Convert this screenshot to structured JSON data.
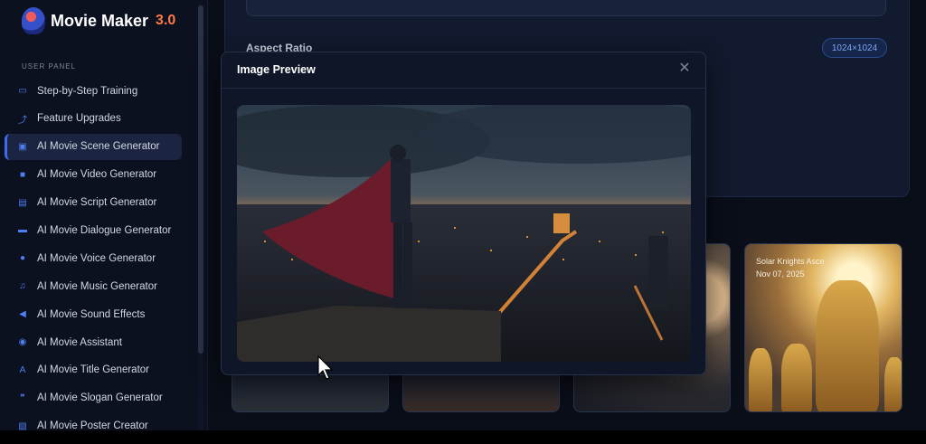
{
  "app": {
    "name": "Movie Maker",
    "version": "3.0"
  },
  "sidebar": {
    "section_label": "USER PANEL",
    "items": [
      {
        "label": "Step-by-Step Training",
        "icon": "training-icon",
        "glyph": "▭",
        "active": false
      },
      {
        "label": "Feature Upgrades",
        "icon": "upgrade-icon",
        "glyph": "⤴",
        "active": false
      },
      {
        "label": "AI Movie Scene Generator",
        "icon": "scene-icon",
        "glyph": "▣",
        "active": true
      },
      {
        "label": "AI Movie Video Generator",
        "icon": "video-icon",
        "glyph": "■",
        "active": false
      },
      {
        "label": "AI Movie Script Generator",
        "icon": "script-icon",
        "glyph": "▤",
        "active": false
      },
      {
        "label": "AI Movie Dialogue Generator",
        "icon": "dialogue-icon",
        "glyph": "▬",
        "active": false
      },
      {
        "label": "AI Movie Voice Generator",
        "icon": "microphone-icon",
        "glyph": "●",
        "active": false
      },
      {
        "label": "AI Movie Music Generator",
        "icon": "music-icon",
        "glyph": "♫",
        "active": false
      },
      {
        "label": "AI Movie Sound Effects",
        "icon": "speaker-icon",
        "glyph": "◀",
        "active": false
      },
      {
        "label": "AI Movie Assistant",
        "icon": "assistant-icon",
        "glyph": "◉",
        "active": false
      },
      {
        "label": "AI Movie Title Generator",
        "icon": "title-icon",
        "glyph": "A",
        "active": false
      },
      {
        "label": "AI Movie Slogan Generator",
        "icon": "quote-icon",
        "glyph": "❞",
        "active": false
      },
      {
        "label": "AI Movie Poster Creator",
        "icon": "poster-icon",
        "glyph": "▧",
        "active": false
      }
    ]
  },
  "main": {
    "aspect_ratio_label": "Aspect Ratio",
    "size_badge": "1024×1024"
  },
  "gallery": {
    "card4_title": "Solar Knights Asce",
    "card4_date": "Nov 07, 2025"
  },
  "modal": {
    "title": "Image Preview",
    "close_glyph": "✕"
  },
  "colors": {
    "accent": "#3a6df0",
    "brand_version": "#ff7a45",
    "background": "#0a0e18"
  }
}
